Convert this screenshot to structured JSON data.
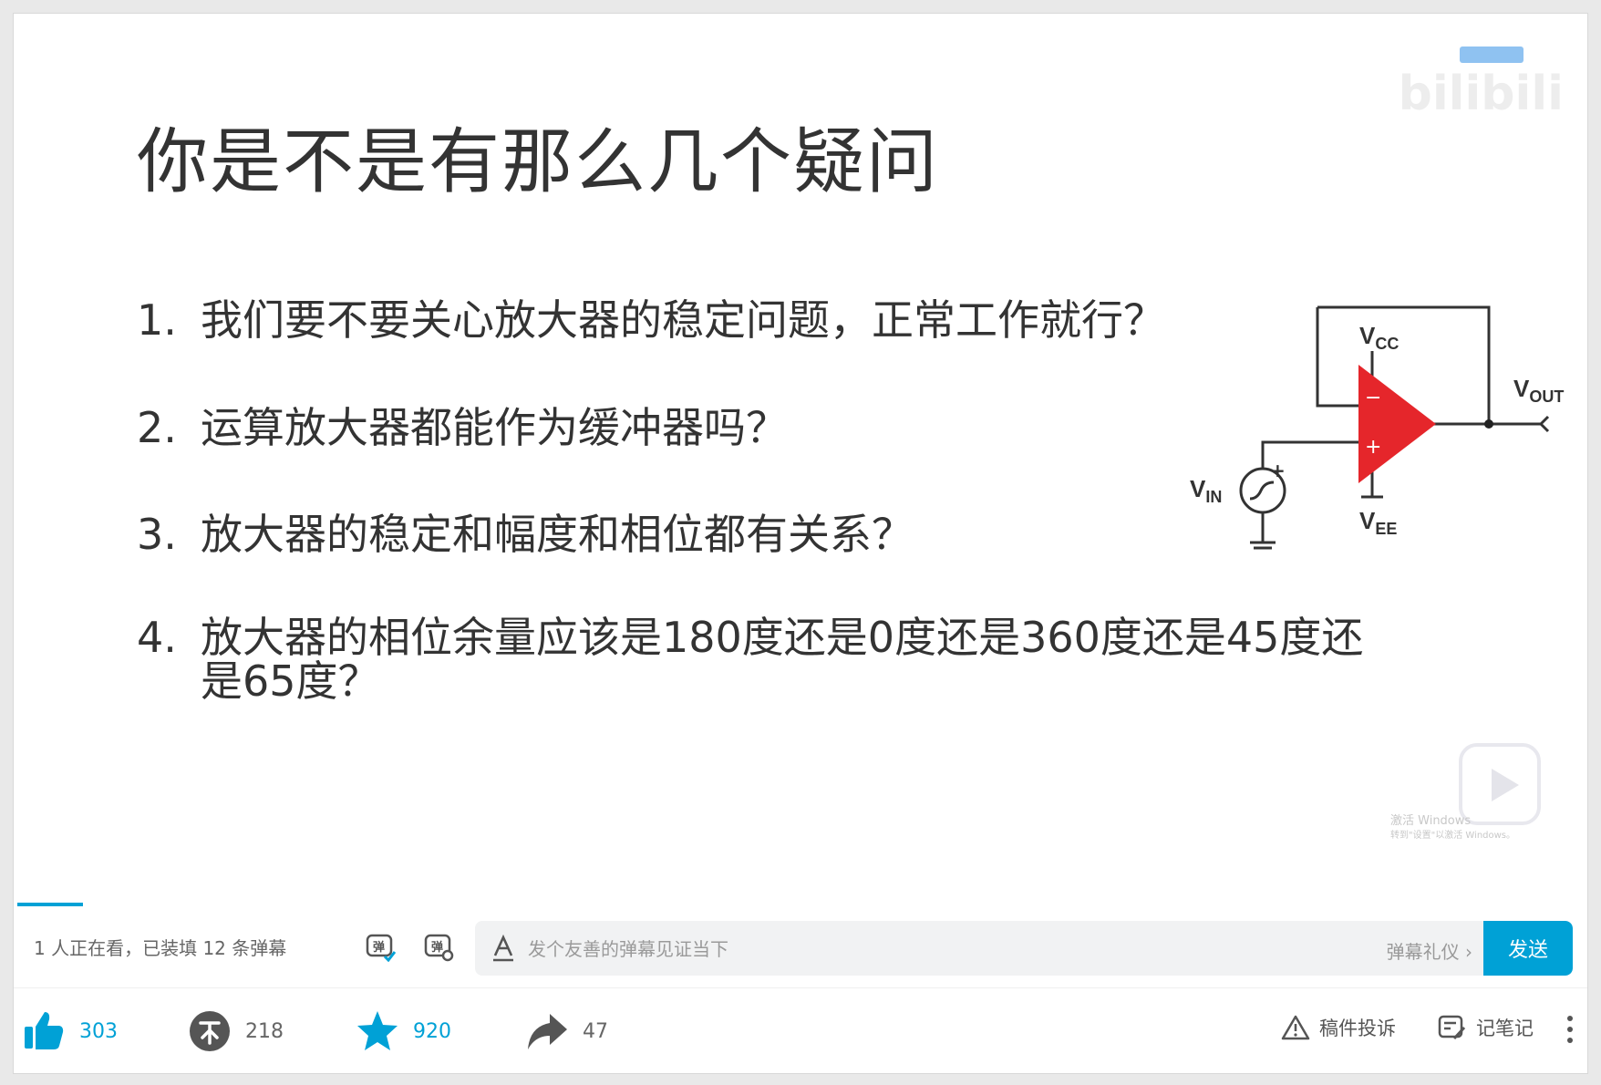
{
  "slide": {
    "title": "你是不是有那么几个疑问",
    "questions": [
      {
        "num": "1.",
        "text": "我们要不要关心放大器的稳定问题，正常工作就行？"
      },
      {
        "num": "2.",
        "text": "运算放大器都能作为缓冲器吗？"
      },
      {
        "num": "3.",
        "text": "放大器的稳定和幅度和相位都有关系？"
      },
      {
        "num": "4.",
        "text": "放大器的相位余量应该是180度还是0度还是360度还是45度还",
        "text2": "是65度？"
      }
    ],
    "circuit": {
      "vcc": "V",
      "vcc_sub": "CC",
      "vee": "V",
      "vee_sub": "EE",
      "vout": "V",
      "vout_sub": "OUT",
      "vin": "V",
      "vin_sub": "IN",
      "plus": "+",
      "minus": "−"
    },
    "watermark": "bilibili",
    "activate_line1": "激活 Windows",
    "activate_line2": "转到\"设置\"以激活 Windows。"
  },
  "danmaku": {
    "viewer_text": "1 人正在看，已装填 12 条弹幕",
    "placeholder": "发个友善的弹幕见证当下",
    "etiquette": "弹幕礼仪 ›",
    "send_label": "发送"
  },
  "actions": {
    "like_count": "303",
    "coin_count": "218",
    "fav_count": "920",
    "share_count": "47",
    "report_label": "稿件投诉",
    "note_label": "记笔记"
  },
  "colors": {
    "accent": "#00a1d6",
    "opamp": "#e5262b"
  }
}
